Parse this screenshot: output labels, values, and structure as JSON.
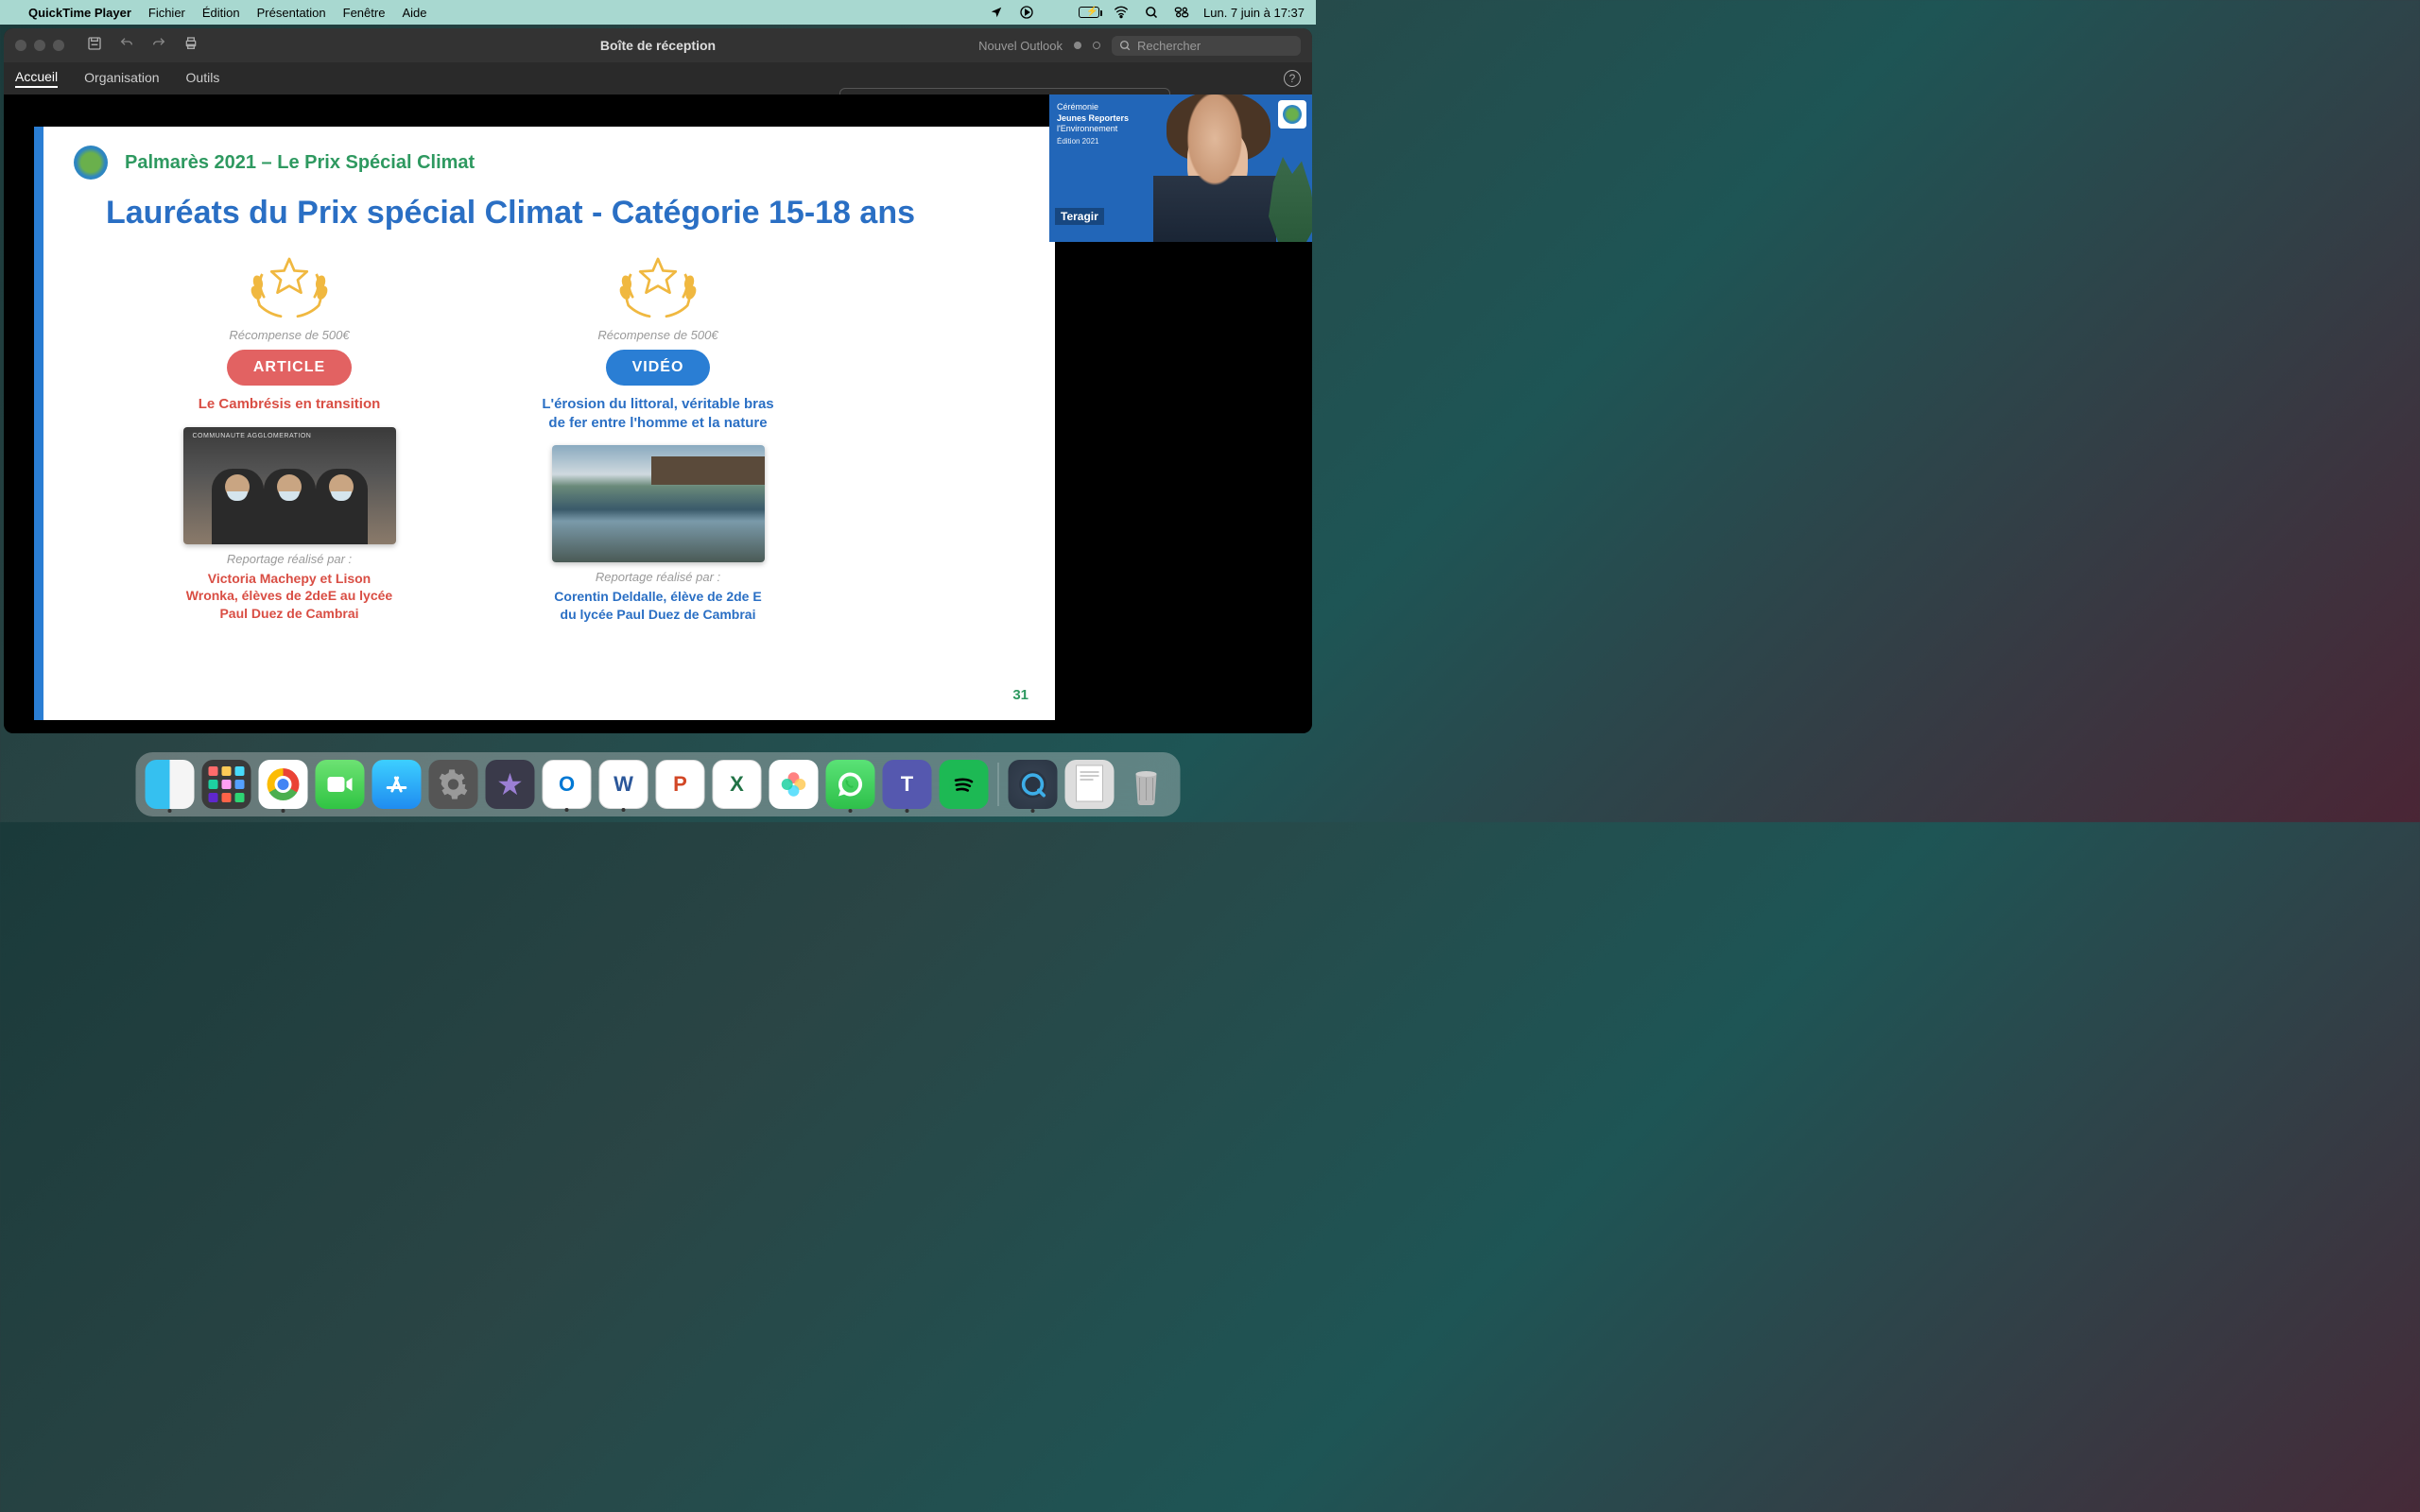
{
  "menubar": {
    "app_name": "QuickTime Player",
    "items": [
      "Fichier",
      "Édition",
      "Présentation",
      "Fenêtre",
      "Aide"
    ],
    "datetime": "Lun. 7 juin à  17:37"
  },
  "window": {
    "title": "Boîte de réception",
    "outlook_label": "Nouvel Outlook",
    "search_placeholder": "Rechercher",
    "tabs": [
      "Accueil",
      "Organisation",
      "Outils"
    ]
  },
  "slide": {
    "subtitle": "Palmarès 2021 – Le Prix Spécial Climat",
    "title": "Lauréats du Prix spécial Climat - Catégorie 15-18 ans",
    "page_number": "31",
    "awards": [
      {
        "reward": "Récompense de 500€",
        "pill": "ARTICLE",
        "title": "Le Cambrésis en transition",
        "report_label": "Reportage réalisé par :",
        "credit": "Victoria Machepy et Lison Wronka, élèves de 2deE au lycée Paul Duez de Cambrai"
      },
      {
        "reward": "Récompense de 500€",
        "pill": "VIDÉO",
        "title": "L'érosion du littoral, véritable bras de fer entre l'homme et la nature",
        "report_label": "Reportage réalisé par :",
        "credit": "Corentin Deldalle, élève de 2de E du lycée Paul Duez de Cambrai"
      }
    ]
  },
  "video_overlay": {
    "line1": "Cérémonie",
    "line2": "Jeunes Reporters",
    "line3": "l'Environnement",
    "line4": "Édition 2021",
    "name": "Teragir"
  },
  "dock": {
    "items": [
      {
        "name": "finder",
        "icon": "😊",
        "running": true
      },
      {
        "name": "launchpad",
        "icon": ""
      },
      {
        "name": "chrome",
        "icon": "",
        "running": true
      },
      {
        "name": "facetime",
        "icon": "📹"
      },
      {
        "name": "appstore",
        "icon": "A"
      },
      {
        "name": "settings",
        "icon": "⚙"
      },
      {
        "name": "imovie",
        "icon": "★"
      },
      {
        "name": "outlook",
        "icon": "O",
        "running": true
      },
      {
        "name": "word",
        "icon": "W",
        "running": true
      },
      {
        "name": "powerpoint",
        "icon": "P"
      },
      {
        "name": "excel",
        "icon": "X"
      },
      {
        "name": "photos",
        "icon": "✿"
      },
      {
        "name": "whatsapp",
        "icon": "✆",
        "running": true
      },
      {
        "name": "teams",
        "icon": "T",
        "running": true
      },
      {
        "name": "spotify",
        "icon": "♪"
      }
    ],
    "right": [
      {
        "name": "quicktime",
        "icon": "Q",
        "running": true
      },
      {
        "name": "other",
        "icon": "▭"
      },
      {
        "name": "trash",
        "icon": "🗑"
      }
    ]
  }
}
